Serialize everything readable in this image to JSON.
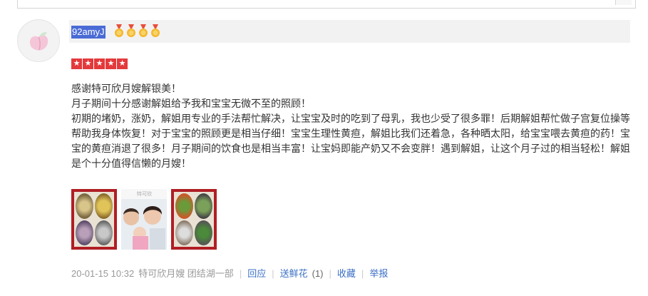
{
  "review": {
    "username": "92amyJ",
    "medal_icons": [
      "medal-icon",
      "medal-icon",
      "medal-icon",
      "medal-icon"
    ],
    "rating": 5,
    "rating_max": 5,
    "paragraphs": [
      "感谢特可欣月嫂解银美！",
      "月子期间十分感谢解姐给予我和宝宝无微不至的照顾！",
      "初期的堵奶，涨奶，解姐用专业的手法帮忙解决，让宝宝及时的吃到了母乳，我也少受了很多罪！后期解姐帮忙做子宫复位操等帮助我身体恢复！对于宝宝的照顾更是相当仔细！宝宝生理性黄疸，解姐比我们还着急，各种晒太阳，给宝宝喂去黄疸的药！宝宝的黄疸消退了很多！月子期间的饮食也是相当丰富！让宝妈即能产奶又不会变胖！遇到解姐，让这个月子过的相当轻松！解姐是个十分值得信懒的月嫂！"
    ],
    "photo_watermark": "特可欣",
    "footer": {
      "date": "20-01-15 10:32",
      "source": "特可欣月嫂 团结湖一部",
      "reply": "回应",
      "flower": "送鲜花",
      "flower_count": "(1)",
      "favorite": "收藏",
      "report": "举报"
    }
  },
  "colors": {
    "accent_link": "#3b6fc6",
    "star_red": "#e4393c",
    "username_highlight": "#4a6bd6"
  }
}
